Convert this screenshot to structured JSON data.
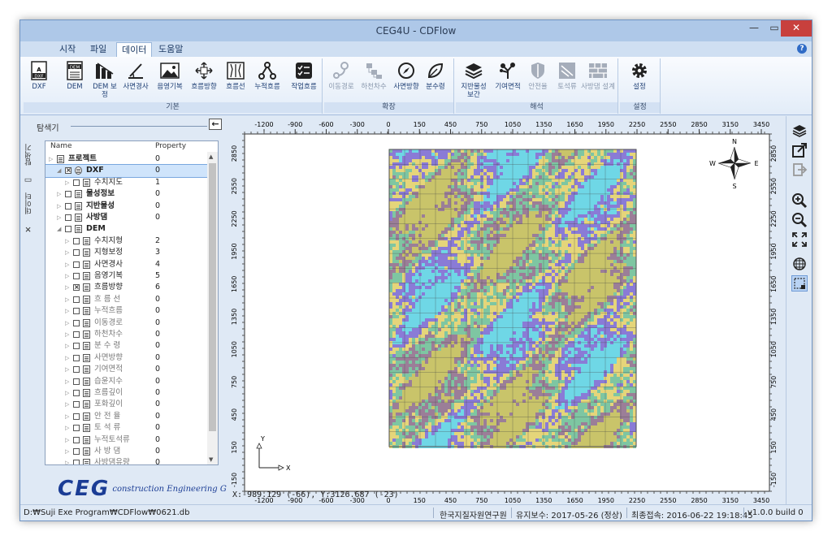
{
  "window": {
    "title": "CEG4U - CDFlow"
  },
  "menu": [
    {
      "label": "시작"
    },
    {
      "label": "파일"
    },
    {
      "label": "데이터"
    },
    {
      "label": "도움말"
    }
  ],
  "ribbon": {
    "groups": [
      {
        "label": "기본"
      },
      {
        "label": "확장"
      },
      {
        "label": "해석"
      },
      {
        "label": "설정"
      }
    ],
    "buttons": [
      {
        "label": "DXF"
      },
      {
        "label": "DEM"
      },
      {
        "label": "DEM 보정"
      },
      {
        "label": "사면경사"
      },
      {
        "label": "음영기복"
      },
      {
        "label": "흐름방향"
      },
      {
        "label": "흐름선"
      },
      {
        "label": "누적흐름"
      },
      {
        "label": "작업흐름"
      },
      {
        "label": "이동경로"
      },
      {
        "label": "하천차수"
      },
      {
        "label": "사면방향"
      },
      {
        "label": "분수령"
      },
      {
        "label": "지반물성 보간"
      },
      {
        "label": "기여면적"
      },
      {
        "label": "안전율"
      },
      {
        "label": "토석류"
      },
      {
        "label": "사방댐 설계"
      },
      {
        "label": "설정"
      }
    ]
  },
  "explorer": {
    "title": "탐색기",
    "back_icon": "arrow-left-icon",
    "side_tabs": [
      "탐색기",
      "데이터"
    ],
    "columns": {
      "name": "Name",
      "property": "Property"
    },
    "rows": [
      {
        "name": "프로젝트",
        "property": "0"
      },
      {
        "name": "DXF",
        "property": "0"
      },
      {
        "name": "수치지도",
        "property": "1"
      },
      {
        "name": "물성정보",
        "property": "0"
      },
      {
        "name": "지반물성",
        "property": "0"
      },
      {
        "name": "사방댐",
        "property": "0"
      },
      {
        "name": "DEM",
        "property": ""
      },
      {
        "name": "수치지형",
        "property": "2"
      },
      {
        "name": "지형보정",
        "property": "3"
      },
      {
        "name": "사면경사",
        "property": "4"
      },
      {
        "name": "음영기복",
        "property": "5"
      },
      {
        "name": "흐름방향",
        "property": "6"
      },
      {
        "name": "흐 름 선",
        "property": "0"
      },
      {
        "name": "누적흐름",
        "property": "0"
      },
      {
        "name": "이동경로",
        "property": "0"
      },
      {
        "name": "하천차수",
        "property": "0"
      },
      {
        "name": "분 수 령",
        "property": "0"
      },
      {
        "name": "사면방향",
        "property": "0"
      },
      {
        "name": "기여면적",
        "property": "0"
      },
      {
        "name": "습윤지수",
        "property": "0"
      },
      {
        "name": "흐름깊이",
        "property": "0"
      },
      {
        "name": "포화깊이",
        "property": "0"
      },
      {
        "name": "안 전 율",
        "property": "0"
      },
      {
        "name": "토 석 류",
        "property": "0"
      },
      {
        "name": "누적토석류",
        "property": "0"
      },
      {
        "name": "사 방 댐",
        "property": "0"
      },
      {
        "name": "사방댐유량",
        "property": "0"
      }
    ]
  },
  "logo": {
    "mark": "CEG",
    "text": "construction Engineering Group"
  },
  "map": {
    "x_ticks": [
      "-1200",
      "-900",
      "-600",
      "-300",
      "0",
      "150",
      "450",
      "750",
      "1050",
      "1350",
      "1650",
      "1950",
      "2250",
      "2550",
      "2850",
      "3150",
      "3450"
    ],
    "y_ticks": [
      "2850",
      "2550",
      "2250",
      "1950",
      "1650",
      "1350",
      "1050",
      "750",
      "450",
      "150",
      "-150"
    ],
    "compass": {
      "n": "N",
      "s": "S",
      "e": "E",
      "w": "W"
    },
    "axis_x": "X",
    "axis_y": "Y",
    "palette": [
      "#e5d57a",
      "#8a7bd6",
      "#7ec6a2",
      "#9b7e98",
      "#6fd7e6",
      "#c9c46a"
    ],
    "coords": "X:-989.129 (-66), Y:3126.687 (-23)"
  },
  "status": {
    "path": "D:₩Suji Exe Program₩CDFlow₩0621.db",
    "org": "한국지질자원연구원",
    "maintenance": "유지보수: 2017-05-26 (정상)",
    "last_access": "최종접속: 2016-06-22 19:18:45",
    "version": "v1.0.0 build 0"
  }
}
